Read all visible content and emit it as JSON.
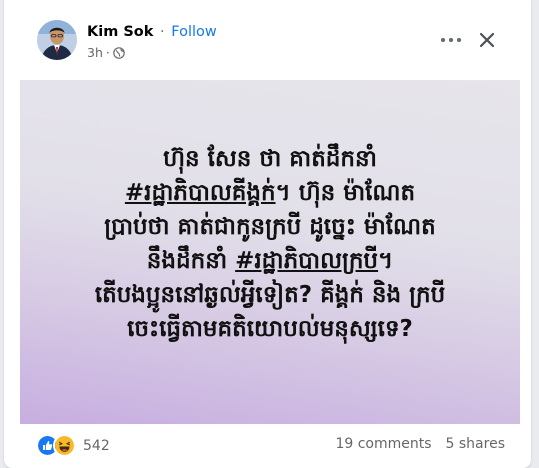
{
  "post": {
    "author": "Kim Sok",
    "separator": "·",
    "follow_label": "Follow",
    "time": "3h",
    "privacy_icon": "globe-icon",
    "more_icon": "more-options-icon",
    "close_icon": "close-icon"
  },
  "image_text": {
    "lines": [
      "ហ៊ុន សែន ថា គាត់ដឹកនាំ",
      "#រដ្ឋាភិបាលគីង្គក់។ ហ៊ុន ម៉ាណែត",
      "ប្រាប់ថា គាត់ជាកូនក្របី ដូច្នេះ ម៉ាណែត",
      "នឹងដឹកនាំ #រដ្ឋាភិបាលក្របី។",
      "តើបងប្អូននៅឆ្ងល់អ្វីទៀត? គីង្គក់ និង ក្របី",
      "ចេះធ្វើតាមគតិយោបល់មនុស្សទេ?"
    ],
    "hashtag_1": "#រដ្ឋាភិបាលគីង្គក់",
    "hashtag_2": "#រដ្ឋាភិបាលក្របី"
  },
  "footer": {
    "reactions": [
      "like-icon",
      "haha-icon"
    ],
    "reaction_count": "542",
    "comments": "19 comments",
    "shares": "5 shares"
  },
  "colors": {
    "follow": "#1877f2",
    "like": "#1877f2",
    "haha": "#f7b928",
    "gradient_bottom": "#c7aee0",
    "gradient_top": "#e6e5ea"
  }
}
